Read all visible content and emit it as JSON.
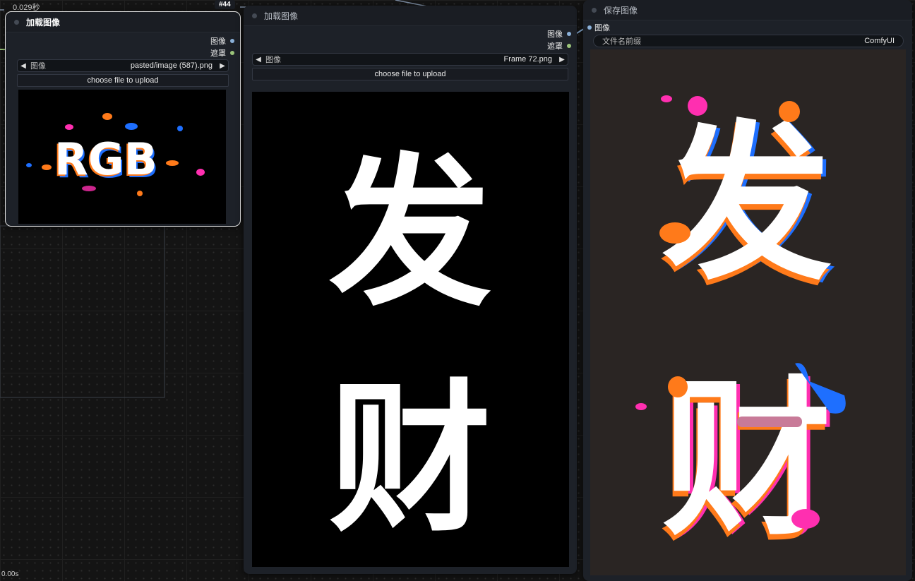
{
  "canvas": {
    "top_timer": "0.029秒",
    "bottom_timer": "0.00s"
  },
  "node1": {
    "id_badge": "#44",
    "title": "加载图像",
    "outputs": [
      "图像",
      "遮罩"
    ],
    "image_label": "图像",
    "image_value": "pasted/image (587).png",
    "upload_label": "choose file to upload",
    "preview_text": "RGB"
  },
  "node2": {
    "title": "加载图像",
    "outputs": [
      "图像",
      "遮罩"
    ],
    "image_label": "图像",
    "image_value": "Frame 72.png",
    "upload_label": "choose file to upload",
    "preview_text": [
      "发",
      "财"
    ]
  },
  "node3": {
    "title": "保存图像",
    "input": "图像",
    "prefix_label": "文件名前缀",
    "prefix_value": "ComfyUI",
    "preview_text": [
      "发",
      "财"
    ]
  },
  "icons": {
    "prev": "triangle-left-icon",
    "next": "triangle-right-icon"
  },
  "colors": {
    "canvas": "#141414",
    "node": "#1d2128",
    "image_socket": "#8ab0d8",
    "mask_socket": "#9bc47a",
    "orange": "#ff7a1a",
    "blue": "#1e6fff",
    "magenta": "#ff2fb0"
  }
}
